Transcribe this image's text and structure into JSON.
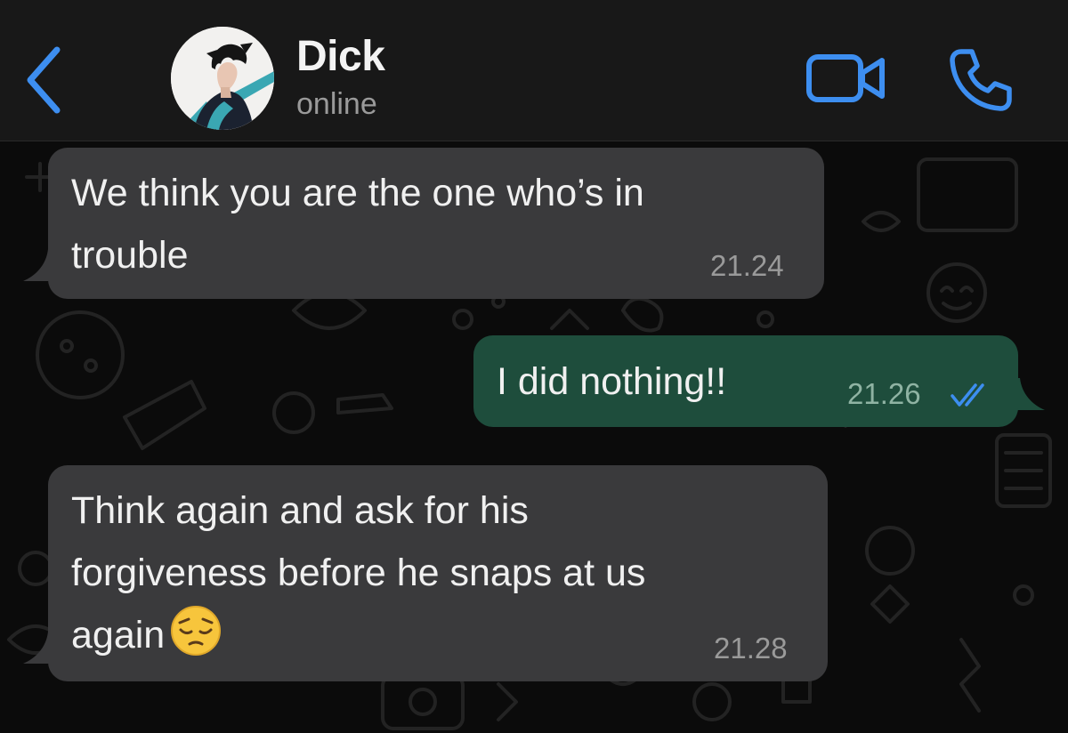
{
  "header": {
    "contact_name": "Dick",
    "contact_status": "online",
    "back_icon": "chevron-left-icon",
    "video_icon": "video-camera-icon",
    "call_icon": "phone-icon"
  },
  "colors": {
    "accent": "#3d8ef0",
    "incoming_bubble": "#3a3a3c",
    "outgoing_bubble": "#1e4d3c",
    "background": "#0b0b0b",
    "header": "#181818"
  },
  "messages": [
    {
      "direction": "incoming",
      "text": "We think you are the one who’s in\ntrouble",
      "time": "21.24"
    },
    {
      "direction": "outgoing",
      "text": "I did nothing!!",
      "time": "21.26",
      "status_icon": "double-check-read-icon"
    },
    {
      "direction": "incoming",
      "text": "Think again and ask for his\nforgiveness before he snaps at us\nagain",
      "emoji": "pensive-face-emoji",
      "time": "21.28"
    }
  ]
}
